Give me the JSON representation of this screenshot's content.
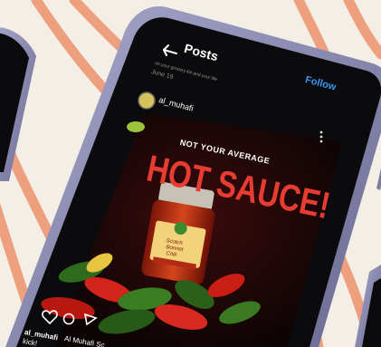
{
  "header": {
    "title": "Posts",
    "follow_label": "Follow",
    "prev_caption": "on your grocery list and your life",
    "prev_date": "June 19"
  },
  "post": {
    "username": "al_muhafi",
    "headline_top": "NOT YOUR AVERAGE",
    "headline_main": "HOT SAUCE!",
    "jar_label_line1": "Scotch",
    "jar_label_line2": "Bonnet",
    "jar_label_line3": "Chili",
    "caption_user": "al_muhafi",
    "caption_text": "Al Muhafi Sc",
    "caption_more": "kick!"
  },
  "colors": {
    "background": "#f3efe6",
    "stripe": "#ee9f7e",
    "phone_frame": "#8a8ab0",
    "screen": "#0b0b0d",
    "headline": "#e63c31",
    "accent_blue": "#3897f0"
  }
}
